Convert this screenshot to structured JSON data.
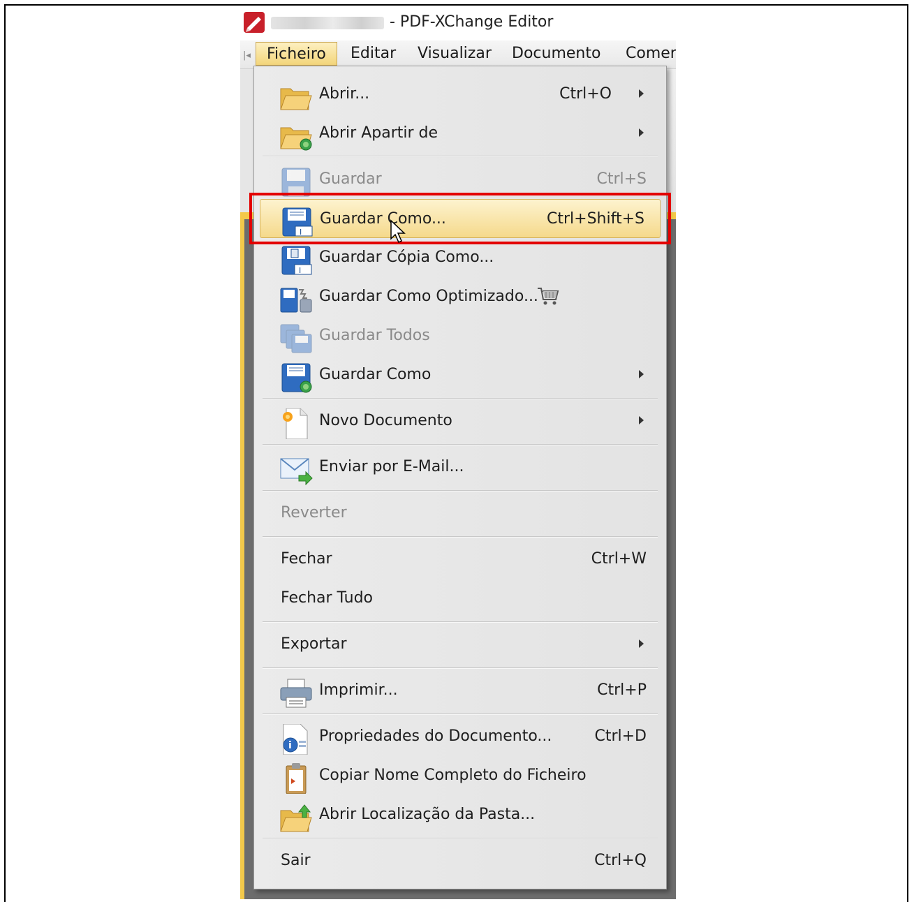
{
  "window": {
    "title": "- PDF-XChange Editor"
  },
  "menubar": {
    "items": [
      "Ficheiro",
      "Editar",
      "Visualizar",
      "Documento",
      "Comer"
    ],
    "active": "Ficheiro"
  },
  "menu": {
    "items": [
      {
        "label": "Abrir...",
        "shortcut": "Ctrl+O",
        "submenu": true,
        "icon": "folder-open-icon"
      },
      {
        "label": "Abrir Apartir de",
        "shortcut": "",
        "submenu": true,
        "icon": "folder-globe-icon"
      },
      {
        "label": "Guardar",
        "shortcut": "Ctrl+S",
        "disabled": true,
        "icon": "floppy-disk-icon"
      },
      {
        "label": "Guardar Como...",
        "shortcut": "Ctrl+Shift+S",
        "highlighted": true,
        "icon": "floppy-save-as-icon"
      },
      {
        "label": "Guardar Cópia Como...",
        "shortcut": "",
        "icon": "floppy-copy-icon"
      },
      {
        "label": "Guardar Como Optimizado...",
        "shortcut": "",
        "icon": "floppy-optimize-icon",
        "badge_icon": "shopping-cart-icon"
      },
      {
        "label": "Guardar Todos",
        "shortcut": "",
        "disabled": true,
        "icon": "floppy-save-all-icon"
      },
      {
        "label": "Guardar Como",
        "shortcut": "",
        "submenu": true,
        "icon": "floppy-globe-icon"
      },
      {
        "label": "Novo Documento",
        "shortcut": "",
        "submenu": true,
        "icon": "new-document-icon"
      },
      {
        "label": "Enviar por E-Mail...",
        "shortcut": "",
        "icon": "email-send-icon"
      },
      {
        "label": "Reverter",
        "shortcut": "",
        "disabled": true
      },
      {
        "label": "Fechar",
        "shortcut": "Ctrl+W"
      },
      {
        "label": "Fechar Tudo",
        "shortcut": ""
      },
      {
        "label": "Exportar",
        "shortcut": "",
        "submenu": true
      },
      {
        "label": "Imprimir...",
        "shortcut": "Ctrl+P",
        "icon": "printer-icon"
      },
      {
        "label": "Propriedades do Documento...",
        "shortcut": "Ctrl+D",
        "icon": "document-properties-icon"
      },
      {
        "label": "Copiar Nome Completo do Ficheiro",
        "shortcut": "",
        "icon": "clipboard-icon"
      },
      {
        "label": "Abrir Localização da Pasta...",
        "shortcut": "",
        "icon": "folder-arrow-icon"
      },
      {
        "label": "Sair",
        "shortcut": "Ctrl+Q"
      }
    ]
  },
  "colors": {
    "highlight_box": "#e30000",
    "menu_hover": "#f5d98b",
    "accent_yellow": "#f3c94a"
  }
}
